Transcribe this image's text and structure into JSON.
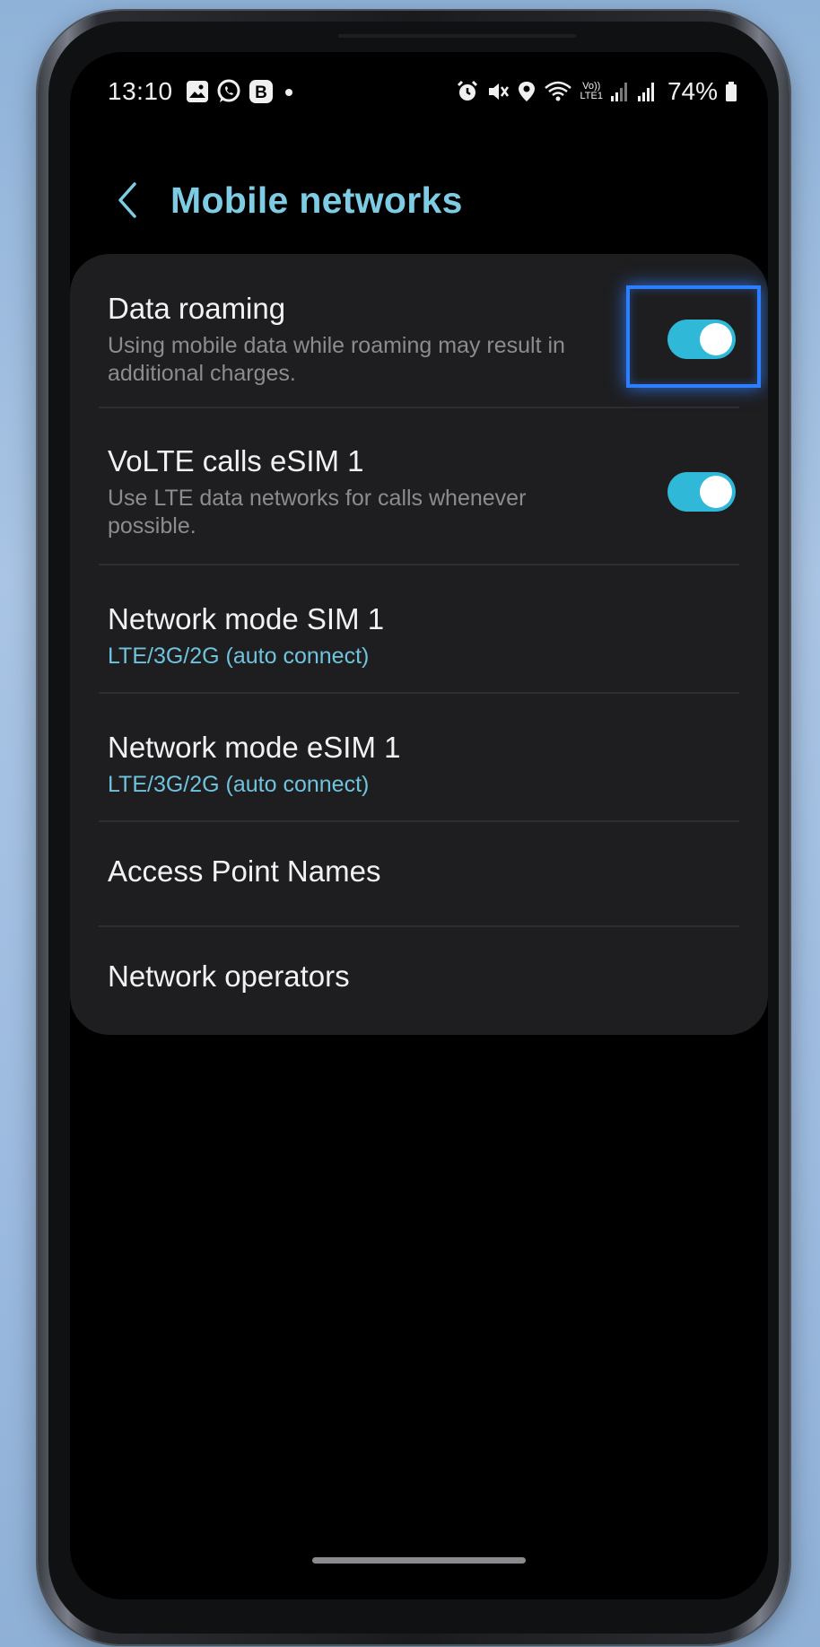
{
  "statusbar": {
    "time": "13:10",
    "left_icons": [
      "gallery-icon",
      "whatsapp-icon",
      "b-app-icon",
      "notification-dot-icon"
    ],
    "right_icons": [
      "alarm-icon",
      "mute-icon",
      "location-icon",
      "wifi-icon",
      "volte-icon",
      "signal-icon",
      "signal-icon"
    ],
    "volte_label_top": "Vo))",
    "volte_label_bottom": "LTE1",
    "battery_percent": "74%"
  },
  "header": {
    "title": "Mobile networks"
  },
  "settings": {
    "data_roaming": {
      "title": "Data roaming",
      "subtitle": "Using mobile data while roaming may result in additional charges.",
      "toggle_on": true
    },
    "volte": {
      "title": "VoLTE calls eSIM 1",
      "subtitle": "Use LTE data networks for calls whenever possible.",
      "toggle_on": true
    },
    "network_mode_sim1": {
      "title": "Network mode SIM 1",
      "value": "LTE/3G/2G (auto connect)"
    },
    "network_mode_esim1": {
      "title": "Network mode eSIM 1",
      "value": "LTE/3G/2G (auto connect)"
    },
    "apn": {
      "title": "Access Point Names"
    },
    "operators": {
      "title": "Network operators"
    }
  },
  "colors": {
    "accent": "#7ecbe4",
    "toggle_on": "#2fb8d8",
    "highlight": "#2d7fff",
    "background": "#000000",
    "card": "#1e1e20"
  }
}
